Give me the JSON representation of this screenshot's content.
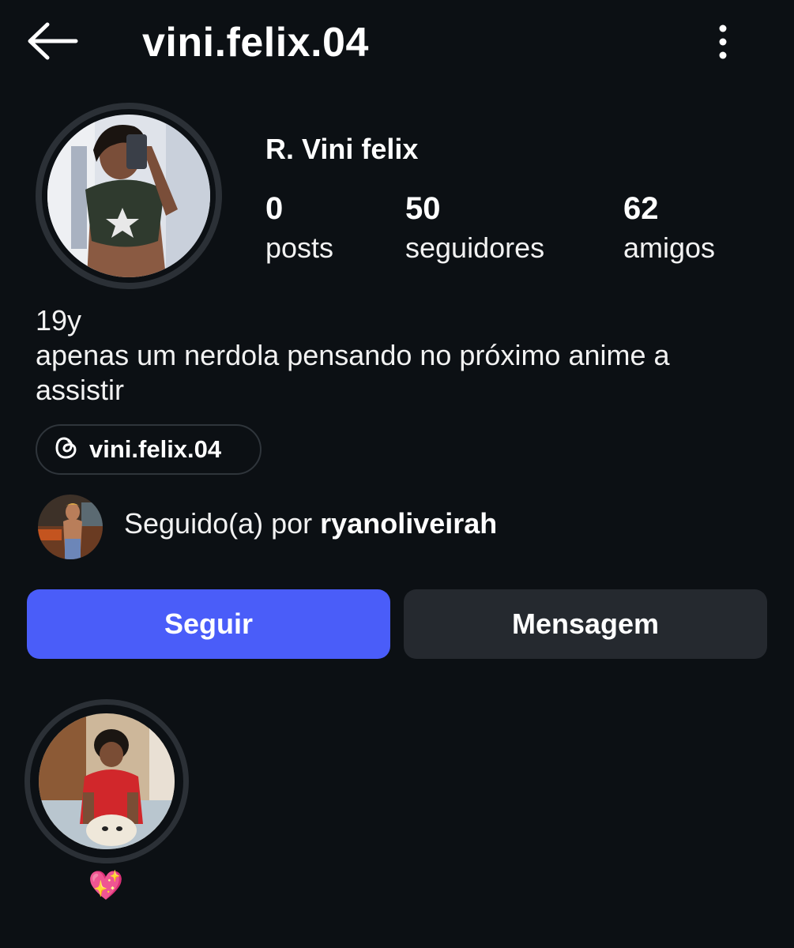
{
  "header": {
    "username": "vini.felix.04",
    "back_icon": "arrow-left-icon",
    "menu_icon": "more-vertical-icon"
  },
  "profile": {
    "display_name": "R. Vini felix",
    "stats": [
      {
        "value": "0",
        "label": "posts"
      },
      {
        "value": "50",
        "label": "seguidores"
      },
      {
        "value": "62",
        "label": "amigos"
      }
    ],
    "bio_lines": [
      "19y",
      "apenas um nerdola pensando no próximo anime a",
      "assistir"
    ]
  },
  "threads_link": {
    "icon": "threads-icon",
    "label": "vini.felix.04"
  },
  "followed_by": {
    "prefix": "Seguido(a) por ",
    "username": "ryanoliveirah"
  },
  "actions": {
    "follow_label": "Seguir",
    "message_label": "Mensagem"
  },
  "highlight": {
    "label": "💖"
  },
  "colors": {
    "background": "#0c1014",
    "follow_button": "#4a5df9",
    "message_button": "#25292f",
    "ring": "#2b3036"
  }
}
